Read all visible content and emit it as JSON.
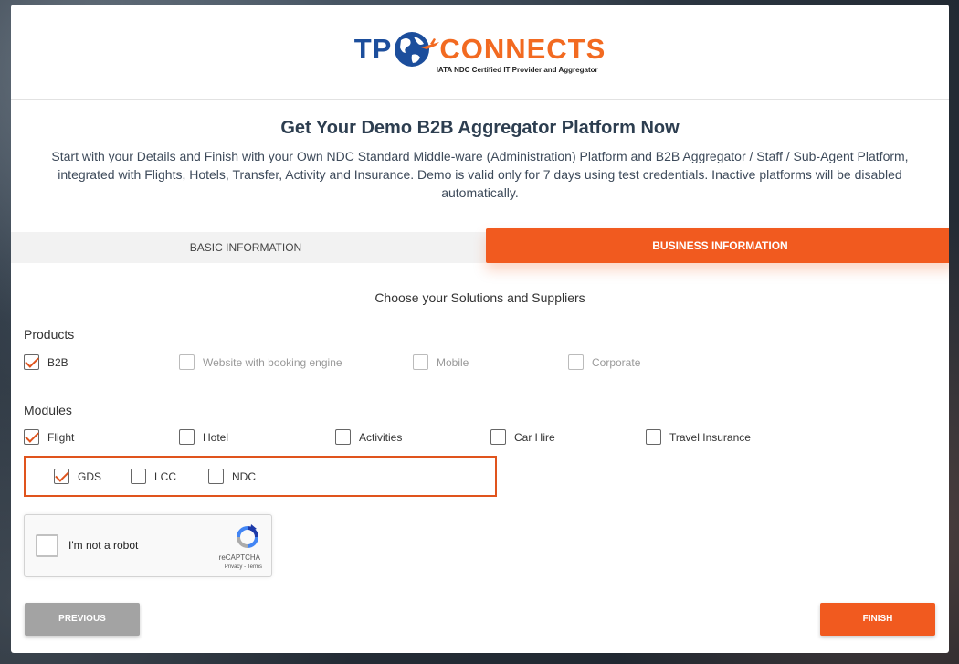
{
  "header": {
    "logo_left": "TP",
    "logo_right": "CONNECTS",
    "logo_tagline": "IATA NDC Certified IT Provider and Aggregator"
  },
  "title": "Get Your Demo B2B Aggregator Platform Now",
  "description": "Start with your Details and Finish with your Own NDC Standard Middle-ware (Administration) Platform and B2B Aggregator / Staff / Sub-Agent Platform, integrated with Flights, Hotels, Transfer, Activity and Insurance. Demo is valid only for 7 days using test credentials. Inactive platforms will be disabled automatically.",
  "tabs": {
    "basic": "BASIC INFORMATION",
    "business": "BUSINESS INFORMATION"
  },
  "subtitle": "Choose your Solutions and Suppliers",
  "products": {
    "label": "Products",
    "items": [
      {
        "label": "B2B",
        "checked": true,
        "disabled": false
      },
      {
        "label": "Website with booking engine",
        "checked": false,
        "disabled": true
      },
      {
        "label": "Mobile",
        "checked": false,
        "disabled": true
      },
      {
        "label": "Corporate",
        "checked": false,
        "disabled": true
      }
    ]
  },
  "modules": {
    "label": "Modules",
    "items": [
      {
        "label": "Flight",
        "checked": true
      },
      {
        "label": "Hotel",
        "checked": false
      },
      {
        "label": "Activities",
        "checked": false
      },
      {
        "label": "Car Hire",
        "checked": false
      },
      {
        "label": "Travel Insurance",
        "checked": false
      }
    ]
  },
  "flight_suppliers": [
    {
      "label": "GDS",
      "checked": true
    },
    {
      "label": "LCC",
      "checked": false
    },
    {
      "label": "NDC",
      "checked": false
    }
  ],
  "captcha": {
    "text": "I'm not a robot",
    "brand": "reCAPTCHA",
    "links": "Privacy - Terms"
  },
  "buttons": {
    "previous": "PREVIOUS",
    "finish": "FINISH"
  },
  "colors": {
    "accent": "#f15a1f",
    "brand_blue": "#1c4e9c",
    "button_gray": "#a3a3a3"
  }
}
